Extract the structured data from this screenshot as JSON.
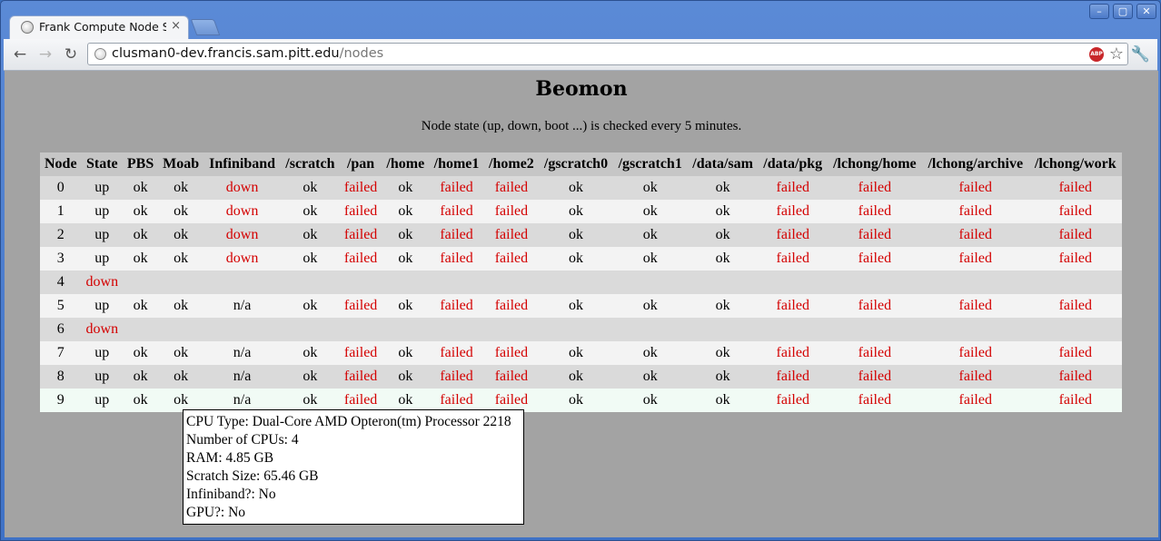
{
  "browser": {
    "tab_title": "Frank Compute Node S",
    "tab_close": "×",
    "url_host": "clusman0-dev.francis.sam.pitt.edu",
    "url_path": "/nodes",
    "abp_label": "ABP",
    "window_controls": [
      "–",
      "▢",
      "✕"
    ]
  },
  "page": {
    "heading": "Beomon",
    "note": "Node state (up, down, boot ...) is checked every 5 minutes."
  },
  "table": {
    "headers": [
      "Node",
      "State",
      "PBS",
      "Moab",
      "Infiniband",
      "/scratch",
      "/pan",
      "/home",
      "/home1",
      "/home2",
      "/gscratch0",
      "/gscratch1",
      "/data/sam",
      "/data/pkg",
      "/lchong/home",
      "/lchong/archive",
      "/lchong/work"
    ],
    "rows": [
      [
        "0",
        "up",
        "ok",
        "ok",
        "down",
        "ok",
        "failed",
        "ok",
        "failed",
        "failed",
        "ok",
        "ok",
        "ok",
        "failed",
        "failed",
        "failed",
        "failed"
      ],
      [
        "1",
        "up",
        "ok",
        "ok",
        "down",
        "ok",
        "failed",
        "ok",
        "failed",
        "failed",
        "ok",
        "ok",
        "ok",
        "failed",
        "failed",
        "failed",
        "failed"
      ],
      [
        "2",
        "up",
        "ok",
        "ok",
        "down",
        "ok",
        "failed",
        "ok",
        "failed",
        "failed",
        "ok",
        "ok",
        "ok",
        "failed",
        "failed",
        "failed",
        "failed"
      ],
      [
        "3",
        "up",
        "ok",
        "ok",
        "down",
        "ok",
        "failed",
        "ok",
        "failed",
        "failed",
        "ok",
        "ok",
        "ok",
        "failed",
        "failed",
        "failed",
        "failed"
      ],
      [
        "4",
        "down",
        "",
        "",
        "",
        "",
        "",
        "",
        "",
        "",
        "",
        "",
        "",
        "",
        "",
        "",
        ""
      ],
      [
        "5",
        "up",
        "ok",
        "ok",
        "n/a",
        "ok",
        "failed",
        "ok",
        "failed",
        "failed",
        "ok",
        "ok",
        "ok",
        "failed",
        "failed",
        "failed",
        "failed"
      ],
      [
        "6",
        "down",
        "",
        "",
        "",
        "",
        "",
        "",
        "",
        "",
        "",
        "",
        "",
        "",
        "",
        "",
        ""
      ],
      [
        "7",
        "up",
        "ok",
        "ok",
        "n/a",
        "ok",
        "failed",
        "ok",
        "failed",
        "failed",
        "ok",
        "ok",
        "ok",
        "failed",
        "failed",
        "failed",
        "failed"
      ],
      [
        "8",
        "up",
        "ok",
        "ok",
        "n/a",
        "ok",
        "failed",
        "ok",
        "failed",
        "failed",
        "ok",
        "ok",
        "ok",
        "failed",
        "failed",
        "failed",
        "failed"
      ],
      [
        "9",
        "up",
        "ok",
        "ok",
        "n/a",
        "ok",
        "failed",
        "ok",
        "failed",
        "failed",
        "ok",
        "ok",
        "ok",
        "failed",
        "failed",
        "failed",
        "failed"
      ]
    ],
    "hovered_row": 9
  },
  "tooltip": {
    "lines": [
      "CPU Type: Dual-Core AMD Opteron(tm) Processor 2218",
      "Number of CPUs: 4",
      "RAM: 4.85 GB",
      "Scratch Size: 65.46 GB",
      "Infiniband?: No",
      "GPU?: No"
    ]
  },
  "colors": {
    "bad": "#d40000",
    "page_background": "#a3a3a3",
    "header_background": "#c6c6c6"
  },
  "icons": {
    "back": "back-arrow-icon",
    "forward": "forward-arrow-icon",
    "reload": "reload-icon",
    "globe": "globe-icon",
    "bookmark": "star-icon",
    "settings": "wrench-icon"
  }
}
